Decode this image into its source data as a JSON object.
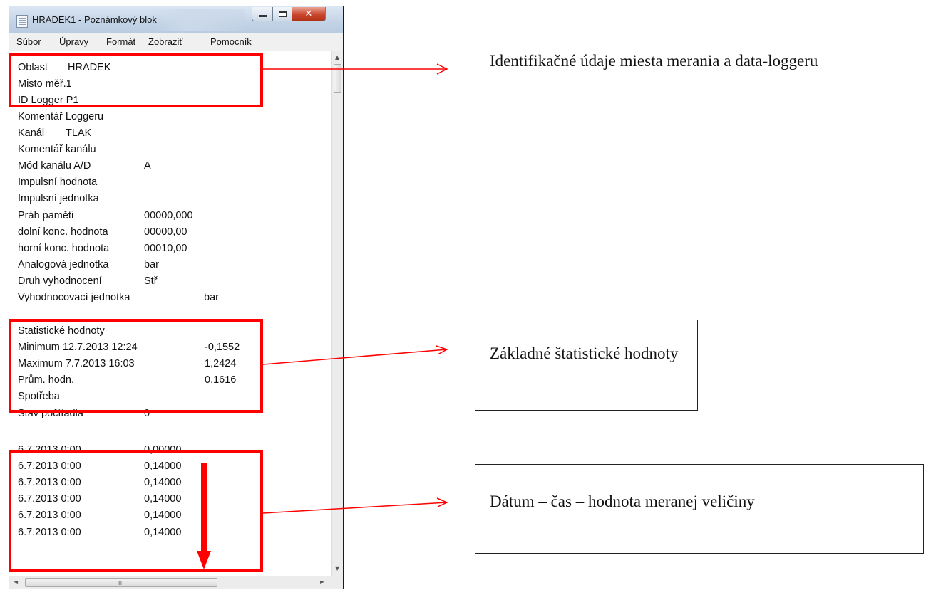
{
  "window": {
    "title": "HRADEK1 - Poznámkový blok",
    "controls": {
      "close_glyph": "✕"
    }
  },
  "menu": [
    "Súbor",
    "Úpravy",
    "Formát",
    "Zobraziť",
    "Pomocník"
  ],
  "scrollbar": {
    "up": "▲",
    "down": "▼",
    "left": "◄",
    "right": "►",
    "grip": "III"
  },
  "lines": [
    {
      "a": "Oblast",
      "b": "HRADEK"
    },
    {
      "a": "Misto měř.1"
    },
    {
      "a": "ID Logger P1"
    },
    {
      "a": "Komentář Loggeru"
    },
    {
      "a": "Kanál",
      "b": "TLAK"
    },
    {
      "a": "Komentář kanálu"
    },
    {
      "a": "Mód kanálu A/D",
      "b": "A"
    },
    {
      "a": "Impulsní hodnota"
    },
    {
      "a": "Impulsní jednotka"
    },
    {
      "a": "Práh paměti",
      "b": "00000,000"
    },
    {
      "a": "dolní konc. hodnota",
      "b": "00000,00"
    },
    {
      "a": "horní konc. hodnota",
      "b": "00010,00"
    },
    {
      "a": "Analogová jednotka",
      "b": "bar"
    },
    {
      "a": "Druh vyhodnocení",
      "b": "Stř"
    },
    {
      "a": "Vyhodnocovací jednotka",
      "b": "bar"
    },
    {
      "a": "Statistické hodnoty"
    },
    {
      "a": "Minimum  12.7.2013 12:24",
      "b": "-0,1552"
    },
    {
      "a": "Maximum  7.7.2013 16:03",
      "b": "1,2424"
    },
    {
      "a": "Prům. hodn.",
      "b": "0,1616"
    },
    {
      "a": "Spotřeba"
    },
    {
      "a": "Stav počítadla",
      "b": "0"
    },
    {
      "a": "6.7.2013 0:00",
      "b": "0,00000"
    },
    {
      "a": "6.7.2013 0:00",
      "b": "0,14000"
    },
    {
      "a": "6.7.2013 0:00",
      "b": "0,14000"
    },
    {
      "a": "6.7.2013 0:00",
      "b": "0,14000"
    },
    {
      "a": "6.7.2013 0:00",
      "b": "0,14000"
    },
    {
      "a": "6.7.2013 0:00",
      "b": "0,14000"
    }
  ],
  "callouts": [
    {
      "text": "Identifikačné údaje miesta merania a data-loggeru"
    },
    {
      "text": "Základné štatistické hodnoty"
    },
    {
      "text": "Dátum – čas – hodnota meranej veličiny"
    }
  ],
  "colors": {
    "highlight": "#ff0000",
    "close_button": "#c9462c"
  }
}
